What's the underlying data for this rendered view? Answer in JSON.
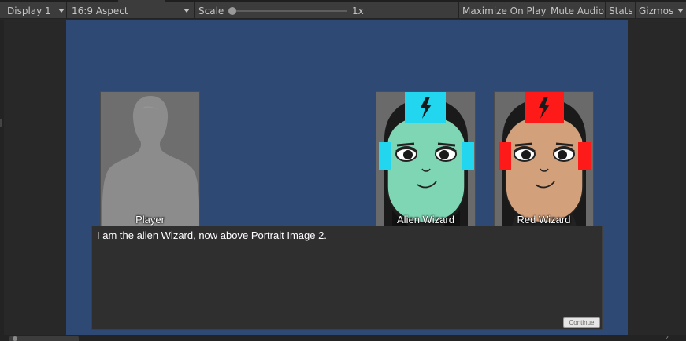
{
  "toolbar": {
    "display": "Display 1",
    "aspect": "16:9 Aspect",
    "scale_label": "Scale",
    "scale_value": "1x",
    "scale_level": 0.0,
    "maximize": "Maximize On Play",
    "mute": "Mute Audio",
    "stats": "Stats",
    "gizmos": "Gizmos"
  },
  "portraits": [
    {
      "name": "Player"
    },
    {
      "name": "Alien Wizard"
    },
    {
      "name": "Red Wizard"
    }
  ],
  "dialog": {
    "text": "I am the alien Wizard, now above Portrait Image 2.",
    "continue_label": "Continue"
  },
  "bottom": {
    "count": "2",
    "more": "⋮"
  },
  "colors": {
    "scene_bg": "#2e4a74",
    "alien_skin": "#7fd6b4",
    "alien_accent": "#22d6ef",
    "red_skin": "#d3a07c",
    "red_accent": "#ff1a1a"
  }
}
